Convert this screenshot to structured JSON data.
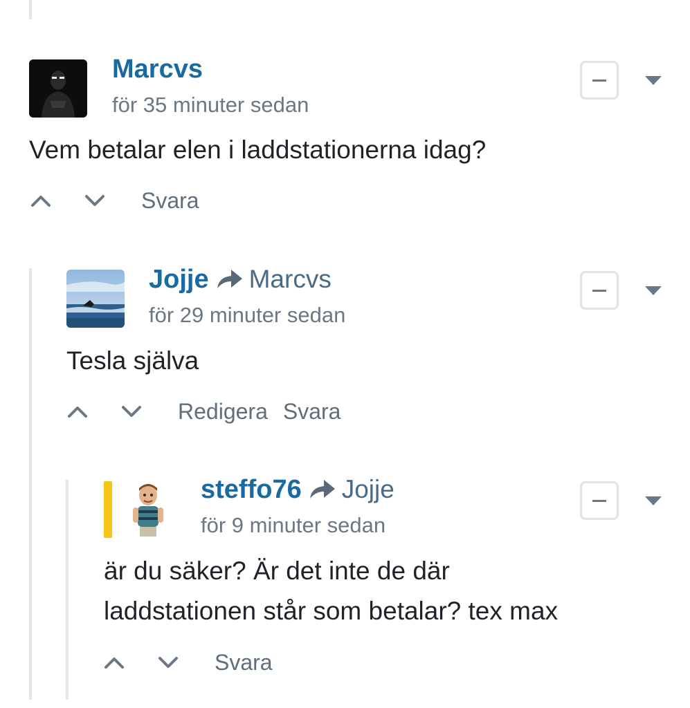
{
  "comments": [
    {
      "author": "Marcvs",
      "reply_to": "",
      "timestamp": "för 35 minuter sedan",
      "body": [
        "Vem betalar elen i laddstationerna idag?"
      ],
      "actions": [
        "Svara"
      ]
    },
    {
      "author": "Jojje",
      "reply_to": "Marcvs",
      "timestamp": "för 29 minuter sedan",
      "body": [
        "Tesla själva"
      ],
      "actions": [
        "Redigera",
        "Svara"
      ]
    },
    {
      "author": "steffo76",
      "reply_to": "Jojje",
      "timestamp": "för 9 minuter sedan",
      "body": [
        "är du säker? Är det inte de där",
        "laddstationen står som betalar? tex max"
      ],
      "actions": [
        "Svara"
      ]
    }
  ],
  "icons": {
    "collapse": "minus-square-icon",
    "menu": "caret-down-icon",
    "upvote": "chevron-up-icon",
    "downvote": "chevron-down-icon",
    "reply_arrow": "share-arrow-icon"
  },
  "colors": {
    "author": "#1a6aa0",
    "thread_line": "#e3e6ea",
    "highlight": "#f5c518"
  }
}
